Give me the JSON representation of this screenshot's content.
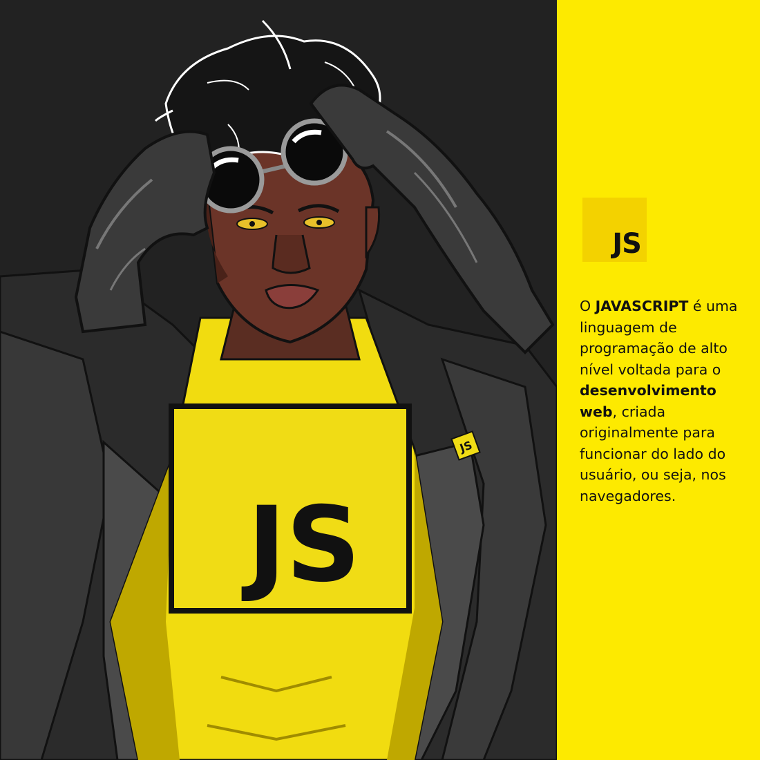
{
  "colors": {
    "panel_background": "#fdea00",
    "logo_background": "#f3d200",
    "illustration_background": "#222222",
    "text": "#111111",
    "shirt_yellow": "#f1dc10"
  },
  "side_panel": {
    "logo_text": "JS",
    "description": {
      "part1": "O ",
      "highlight1": "JAVASCRIPT",
      "part2": " é uma linguagem de programação de alto nível voltada para o ",
      "highlight2": "desenvolvimento web",
      "part3": ", criada originalmente para funcionar do lado do usuário, ou seja, nos navegadores."
    }
  },
  "illustration": {
    "chest_logo_text": "JS",
    "lapel_pin_text": "JS"
  }
}
